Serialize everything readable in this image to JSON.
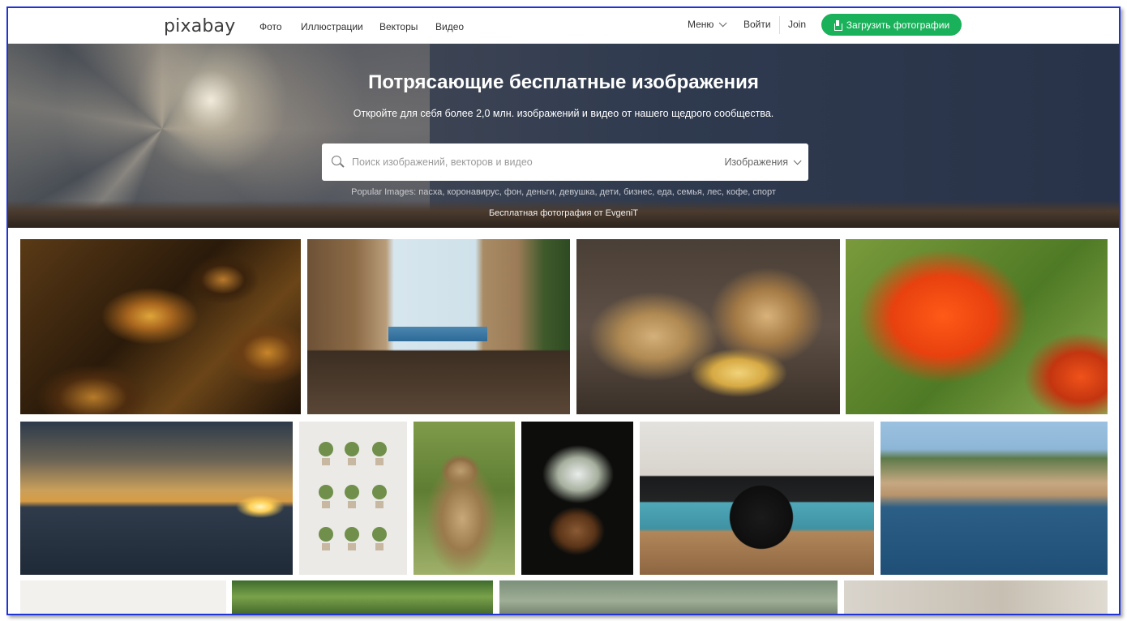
{
  "header": {
    "logo": "pixabay",
    "nav": [
      "Фото",
      "Иллюстрации",
      "Векторы",
      "Видео"
    ],
    "menu_label": "Меню",
    "login_label": "Войти",
    "join_label": "Join",
    "upload_label": "Загрузить фотографии"
  },
  "hero": {
    "title": "Потрясающие бесплатные изображения",
    "subtitle": "Откройте для себя более 2,0 млн. изображений и видео от нашего щедрого сообщества.",
    "search_placeholder": "Поиск изображений, векторов и видео",
    "search_type": "Изображения",
    "popular": "Popular Images: пасха, коронавирус, фон, деньги, девушка, дети, бизнес, еда, семья, лес, кофе, спорт",
    "credit": "Бесплатная фотография от EvgeniT"
  },
  "colors": {
    "accent": "#19b15a",
    "frame": "#1f33d8"
  },
  "icons": {
    "search": "search-icon",
    "chevron": "chevron-down-icon",
    "upload": "upload-icon"
  }
}
